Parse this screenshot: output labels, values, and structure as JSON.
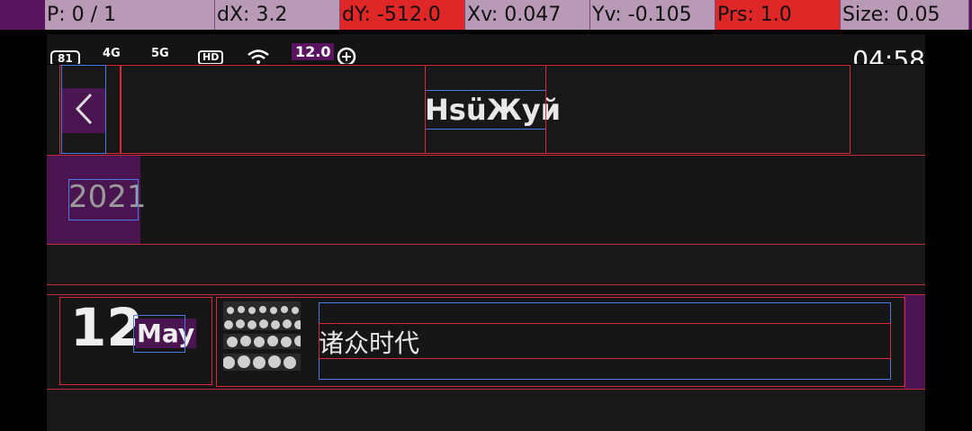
{
  "debug_overlay": {
    "pointer": "P: 0 / 1",
    "dx": "dX: 3.2",
    "dy": "dY: -512.0",
    "xv": "Xv: 0.047",
    "yv": "Yv: -0.105",
    "prs": "Prs: 1.0",
    "size": "Size: 0.05"
  },
  "status_bar": {
    "battery": "81",
    "network1": "4G",
    "network2": "5G",
    "hd": "HD",
    "speed": "12.0",
    "time": "04:58"
  },
  "app_bar": {
    "back_icon": "chevron-left-icon",
    "title": "HsüЖуй"
  },
  "year_tab": {
    "label": "2021"
  },
  "entries": [
    {
      "day": "12",
      "month": "May",
      "title": "诸众时代"
    }
  ],
  "colors": {
    "background": "#141414",
    "highlight": "#4a1550",
    "outline_red": "#d82a3a",
    "outline_blue": "#4a7adf",
    "debug_red": "#e02727"
  }
}
